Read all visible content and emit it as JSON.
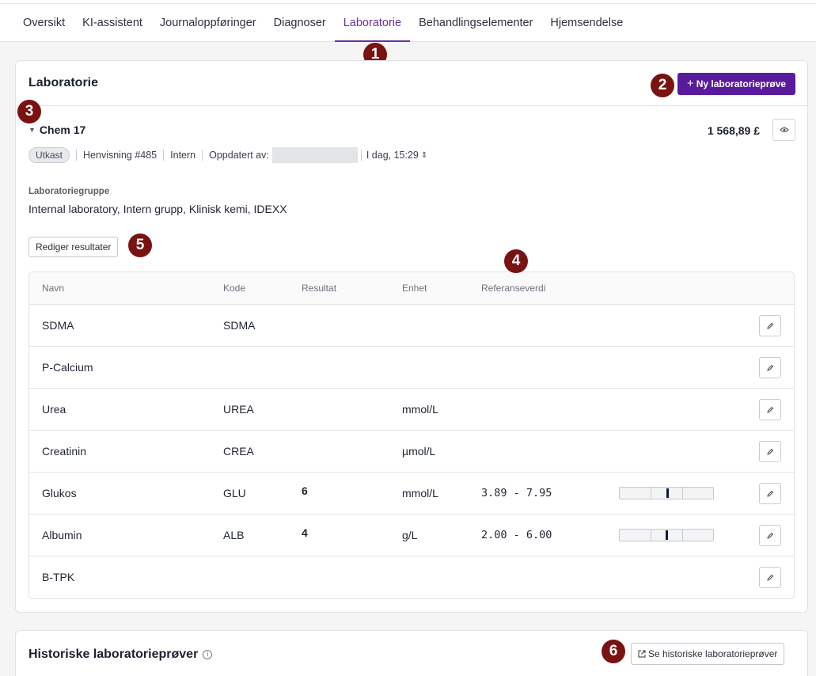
{
  "tabs": [
    {
      "label": "Oversikt"
    },
    {
      "label": "KI-assistent"
    },
    {
      "label": "Journaloppføringer"
    },
    {
      "label": "Diagnoser"
    },
    {
      "label": "Laboratorie"
    },
    {
      "label": "Behandlingselementer"
    },
    {
      "label": "Hjemsendelse"
    }
  ],
  "active_tab": "Laboratorie",
  "badges": [
    "1",
    "2",
    "3",
    "4",
    "5",
    "6"
  ],
  "lab_card": {
    "title": "Laboratorie",
    "new_button": "Ny laboratorieprøve",
    "sample": {
      "name": "Chem 17",
      "price": "1 568,89 £",
      "status": "Utkast",
      "referral": "Henvisning #485",
      "type": "Intern",
      "updated_by_label": "Oppdatert av:",
      "updated_by_prefix": "",
      "updated_time": "I dag, 15:29"
    },
    "group_label": "Laboratoriegruppe",
    "group_value": "Internal laboratory, Intern grupp, Klinisk kemi, IDEXX",
    "edit_results_button": "Rediger resultater",
    "table": {
      "headers": [
        "Navn",
        "Kode",
        "Resultat",
        "Enhet",
        "Referanseverdi"
      ],
      "rows": [
        {
          "name": "SDMA",
          "code": "SDMA",
          "result": "",
          "unit": "",
          "ref": ""
        },
        {
          "name": "P-Calcium",
          "code": "",
          "result": "",
          "unit": "",
          "ref": ""
        },
        {
          "name": "Urea",
          "code": "UREA",
          "result": "",
          "unit": "mmol/L",
          "ref": ""
        },
        {
          "name": "Creatinin",
          "code": "CREA",
          "result": "",
          "unit": "µmol/L",
          "ref": ""
        },
        {
          "name": "Glukos",
          "code": "GLU",
          "result": "6",
          "unit": "mmol/L",
          "ref": "3.89 - 7.95",
          "range_min": 3.89,
          "range_max": 7.95,
          "range_value": 6
        },
        {
          "name": "Albumin",
          "code": "ALB",
          "result": "4",
          "unit": "g/L",
          "ref": "2.00 - 6.00",
          "range_min": 2.0,
          "range_max": 6.0,
          "range_value": 4
        },
        {
          "name": "B-TPK",
          "code": "",
          "result": "",
          "unit": "",
          "ref": ""
        }
      ]
    }
  },
  "history_card": {
    "title": "Historiske laboratorieprøver",
    "button": "Se historiske laboratorieprøver"
  },
  "colors": {
    "accent": "#6b2fa0",
    "primary_button": "#5a1a9c",
    "badge": "#7a1212",
    "range_marker": "#0e1a3c"
  }
}
